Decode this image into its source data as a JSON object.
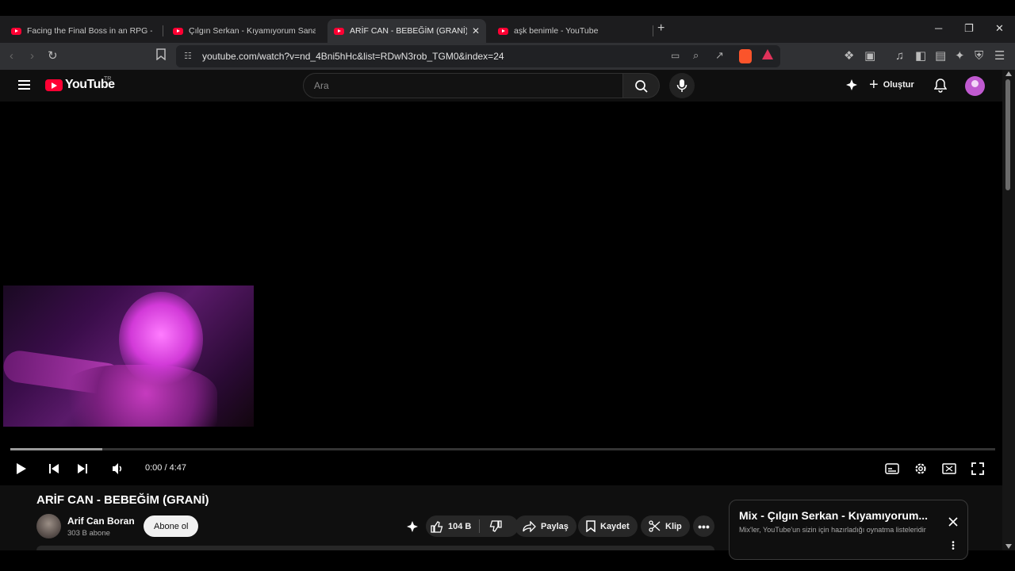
{
  "browser": {
    "tabs": [
      {
        "title": "Facing the Final Boss in an RPG - YouTube",
        "active": false
      },
      {
        "title": "Çılgın Serkan - Kıyamıyorum Sana | D",
        "active": false
      },
      {
        "title": "ARİF CAN - BEBEĞİM (GRANİ) - YouTube",
        "active": true
      },
      {
        "title": "aşk benimle - YouTube",
        "active": false
      }
    ],
    "new_tab": "+",
    "url": "youtube.com/watch?v=nd_4Bni5hHc&list=RDwN3rob_TGM0&index=24",
    "window_controls": {
      "minimize": "─",
      "maximize": "❐",
      "close": "✕"
    },
    "tab_close": "✕"
  },
  "youtube": {
    "logo_text": "YouTube",
    "country_code": "TR",
    "search_placeholder": "Ara",
    "create_label": "Oluştur"
  },
  "player": {
    "current_time": "0:00",
    "duration": "4:47",
    "time_display": "0:00 / 4:47",
    "buffered_fraction": 0.093
  },
  "video": {
    "title": "ARİF CAN - BEBEĞİM (GRANİ)",
    "channel": "Arif Can Boran",
    "subscribers": "303 B abone",
    "subscribe_label": "Abone ol",
    "likes": "104 B",
    "share_label": "Paylaş",
    "save_label": "Kaydet",
    "clip_label": "Klip"
  },
  "mix": {
    "title": "Mix - Çılgın Serkan - Kıyamıyorum...",
    "subtitle": "Mix'ler, YouTube'un sizin için hazırladığı oynatma listeleridir"
  },
  "colors": {
    "brand": "#ff0033",
    "background": "#0f0f0f",
    "chrome": "#202124"
  }
}
